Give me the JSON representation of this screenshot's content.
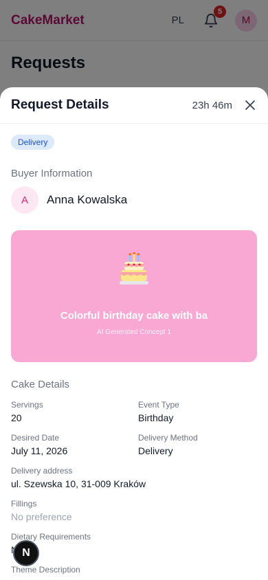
{
  "app": {
    "brand": "CakeMarket",
    "language": "PL",
    "notifications_count": "5",
    "user_initial": "M"
  },
  "page": {
    "title": "Requests"
  },
  "sheet": {
    "title": "Request Details",
    "timer": "23h 46m",
    "tag": "Delivery",
    "buyer_section": "Buyer Information",
    "buyer_initial": "A",
    "buyer_name": "Anna Kowalska",
    "concept": {
      "title": "Colorful birthday cake with ba",
      "subtitle": "AI Generated Concept 1",
      "bg_color": "#f9a8d4"
    },
    "cake_details_label": "Cake Details",
    "fields": {
      "servings": {
        "label": "Servings",
        "value": "20"
      },
      "event_type": {
        "label": "Event Type",
        "value": "Birthday"
      },
      "desired_date": {
        "label": "Desired Date",
        "value": "July 11, 2026"
      },
      "delivery_method": {
        "label": "Delivery Method",
        "value": "Delivery"
      },
      "delivery_address": {
        "label": "Delivery address",
        "value": "ul. Szewska 10, 31-009 Kraków"
      },
      "fillings": {
        "label": "Fillings",
        "value": "No preference"
      },
      "dietary": {
        "label": "Dietary Requirements",
        "value": "N"
      },
      "theme": {
        "label": "Theme Description"
      }
    }
  },
  "fab": {
    "label": "N"
  },
  "colors": {
    "brand": "#b5126b",
    "tag_bg": "#dbeafe",
    "badge": "#dc2626"
  }
}
